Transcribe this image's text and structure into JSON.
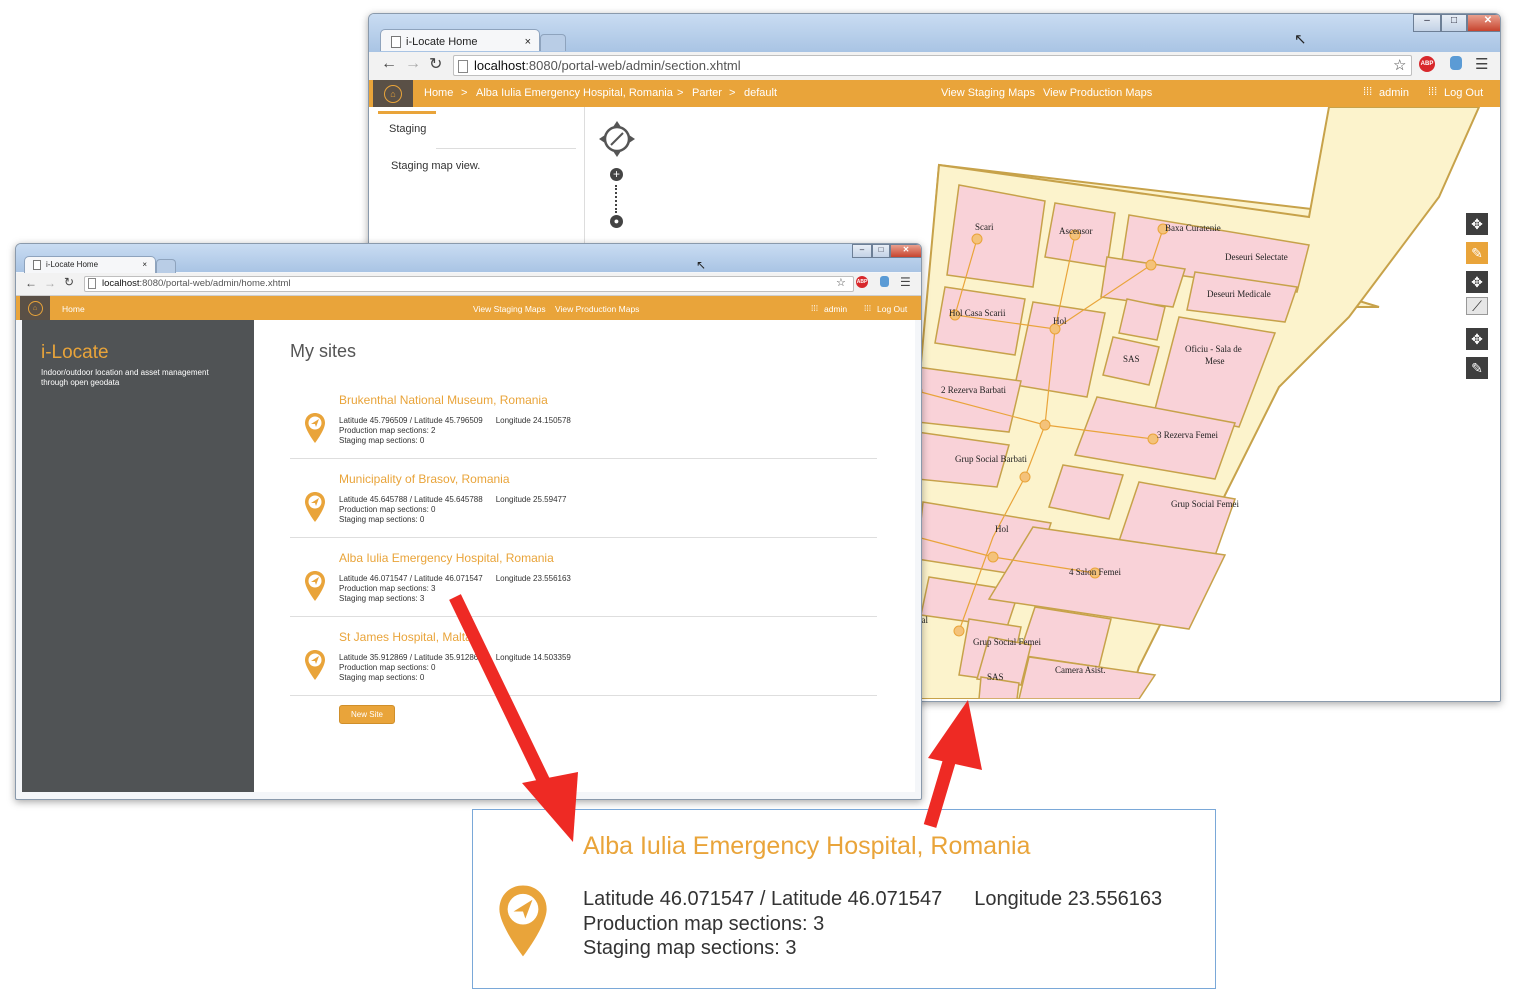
{
  "back_window": {
    "tab_title": "i-Locate Home",
    "tab_close": "×",
    "url_host": "localhost",
    "url_path": ":8080/portal-web/admin/section.xhtml",
    "nav": {
      "breadcrumb": [
        "Home",
        ">",
        "Alba Iulia Emergency Hospital, Romania",
        ">",
        "Parter",
        ">",
        "default"
      ],
      "staging_link": "View Staging Maps",
      "production_link": "View Production Maps",
      "admin": "admin",
      "logout": "Log Out"
    },
    "panel": {
      "tab_label": "Staging",
      "description": "Staging map view."
    },
    "map_labels": {
      "scari": "Scari",
      "ascensor": "Ascensor",
      "baxa": "Baxa Curatenie",
      "deseuri_sel": "Deseuri Selectate",
      "deseuri_med": "Deseuri Medicale",
      "hol_casa": "Hol Casa Scarii",
      "hol1": "Hol",
      "sas1": "SAS",
      "oficiu": "Oficiu - Sala de",
      "oficiu2": "Mese",
      "rezerva2": "2 Rezerva Barbati",
      "rezerva3": "3 Rezerva Femei",
      "grup_barbati": "Grup Social Barbati",
      "grup_femei1": "Grup Social Femei",
      "hol2": "Hol",
      "salon4": "4 Salon Femei",
      "grup_femei2": "Grup Social Femei",
      "sas2": "SAS",
      "camera": "Camera Asist.",
      "ial": "ial"
    }
  },
  "front_window": {
    "tab_title": "i-Locate Home",
    "tab_close": "×",
    "url_host": "localhost",
    "url_path": ":8080/portal-web/admin/home.xhtml",
    "nav": {
      "home": "Home",
      "staging_link": "View Staging Maps",
      "production_link": "View Production Maps",
      "admin": "admin",
      "logout": "Log Out"
    },
    "sidebar": {
      "brand": "i-Locate",
      "tagline_1": "Indoor/outdoor location and asset management",
      "tagline_2": "through open geodata"
    },
    "heading": "My sites",
    "sites": [
      {
        "name": "Brukenthal National Museum, Romania",
        "lat": "Latitude 45.796509 / Latitude 45.796509",
        "lon": "Longitude 24.150578",
        "production": "Production map sections: 2",
        "staging": "Staging map sections: 0"
      },
      {
        "name": "Municipality of Brasov, Romania",
        "lat": "Latitude 45.645788 / Latitude 45.645788",
        "lon": "Longitude 25.59477",
        "production": "Production map sections: 0",
        "staging": "Staging map sections: 0"
      },
      {
        "name": "Alba Iulia Emergency Hospital, Romania",
        "lat": "Latitude 46.071547 / Latitude 46.071547",
        "lon": "Longitude 23.556163",
        "production": "Production map sections: 3",
        "staging": "Staging map sections: 3"
      },
      {
        "name": "St James Hospital, Malta",
        "lat": "Latitude 35.912869 / Latitude 35.912869",
        "lon": "Longitude 14.503359",
        "production": "Production map sections: 0",
        "staging": "Staging map sections: 0"
      }
    ],
    "new_site_button": "New Site"
  },
  "zoom_callout": {
    "name": "Alba Iulia Emergency Hospital, Romania",
    "lat": "Latitude 46.071547 / Latitude 46.071547",
    "lon": "Longitude 23.556163",
    "production": "Production map sections: 3",
    "staging": "Staging map sections: 3"
  },
  "colors": {
    "accent": "#e9a43a",
    "sidebar": "#505355",
    "arrow": "#ee2a24",
    "room_fill": "#f9d2d8",
    "corridor_fill": "#fcf3cc"
  },
  "icons": {
    "home": "home-icon",
    "pin": "location-pin-icon",
    "arrow": "red-arrow",
    "compass": "compass-icon"
  }
}
